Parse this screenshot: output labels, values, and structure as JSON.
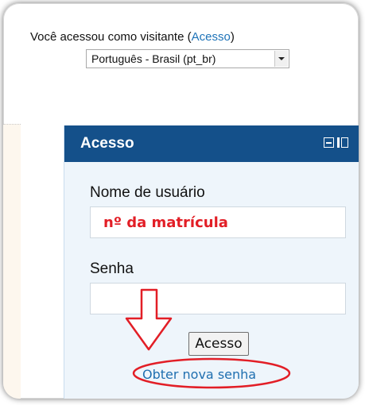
{
  "header": {
    "login_text": "Você acessou como visitante (",
    "login_link": "Acesso",
    "login_close": ")",
    "language": "Português - Brasil (pt_br)"
  },
  "login_block": {
    "title": "Acesso",
    "username_label": "Nome de usuário",
    "username_value": "nº da matrícula",
    "password_label": "Senha",
    "password_value": "",
    "submit_label": "Acesso",
    "forgot_password_link": "Obter nova senha"
  },
  "colors": {
    "header_bg": "#14508a",
    "panel_bg": "#eef5fb",
    "link": "#1f6fb0",
    "annotation": "#e21e26"
  },
  "icons": [
    "minimize-icon",
    "dock-icon",
    "dropdown-arrow-icon",
    "down-arrow-annotation-icon"
  ]
}
